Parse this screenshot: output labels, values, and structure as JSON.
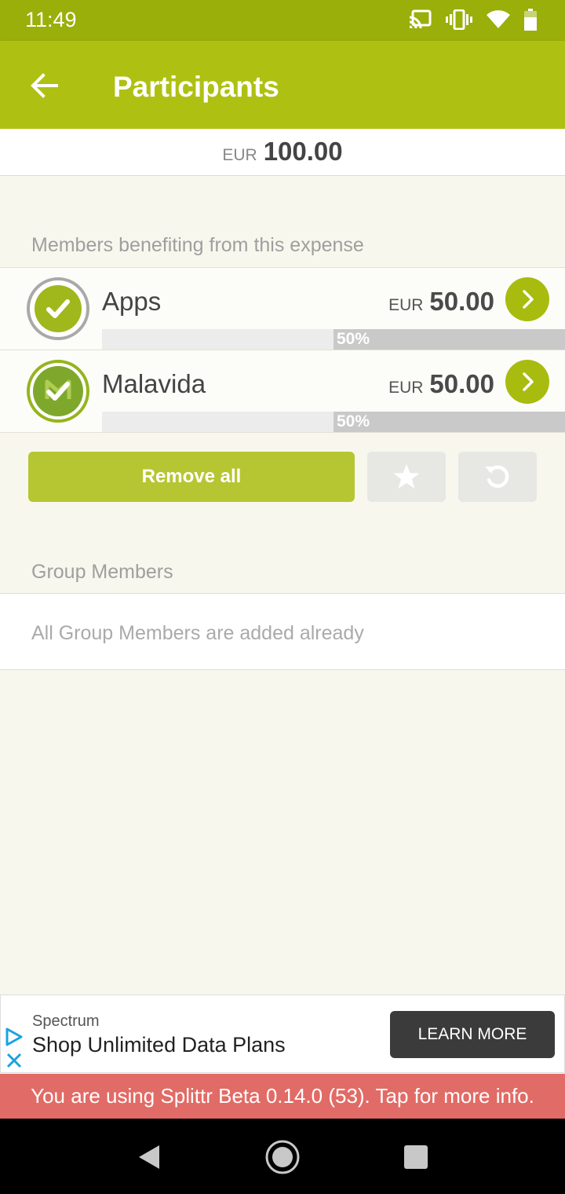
{
  "status_bar": {
    "time": "11:49",
    "icons": [
      "cast-icon",
      "vibrate-icon",
      "wifi-icon",
      "battery-icon"
    ]
  },
  "app_bar": {
    "title": "Participants",
    "back_icon": "arrow-left-icon"
  },
  "total": {
    "currency": "EUR",
    "amount": "100.00"
  },
  "beneficiaries_section": {
    "label": "Members benefiting from this expense"
  },
  "members": [
    {
      "name": "Apps",
      "currency": "EUR",
      "amount": "50.00",
      "share_percent": 50,
      "share_label": "50%"
    },
    {
      "name": "Malavida",
      "currency": "EUR",
      "amount": "50.00",
      "share_percent": 50,
      "share_label": "50%"
    }
  ],
  "actions": {
    "remove_all_label": "Remove all",
    "favorite_icon": "star-icon",
    "reset_icon": "reset-icon"
  },
  "group_members_section": {
    "label": "Group Members",
    "empty_text": "All Group Members are added already"
  },
  "ad": {
    "brand": "Spectrum",
    "headline": "Shop Unlimited Data Plans",
    "cta": "LEARN MORE"
  },
  "beta_banner": {
    "text": "You are using Splittr Beta 0.14.0 (53). Tap for more info."
  },
  "colors": {
    "status_bar": "#9aaf09",
    "app_bar": "#aec112",
    "accent": "#a7bc0e",
    "beta_banner": "#e16b66"
  }
}
